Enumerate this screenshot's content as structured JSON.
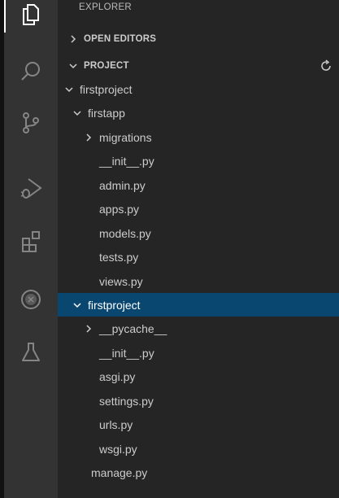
{
  "sidebar": {
    "title": "EXPLORER",
    "open_editors": "OPEN EDITORS",
    "project": "PROJECT"
  },
  "tree": {
    "root_folder": "firstproject",
    "app_folder": "firstapp",
    "app_items": {
      "migrations": "migrations",
      "init": "__init__.py",
      "admin": "admin.py",
      "apps": "apps.py",
      "models": "models.py",
      "tests": "tests.py",
      "views": "views.py"
    },
    "project_folder": "firstproject",
    "project_items": {
      "pycache": "__pycache__",
      "init": "__init__.py",
      "asgi": "asgi.py",
      "settings": "settings.py",
      "urls": "urls.py",
      "wsgi": "wsgi.py"
    },
    "manage": "manage.py"
  },
  "activity_bar": [
    "files-icon",
    "search-icon",
    "source-control-icon",
    "run-debug-icon",
    "extensions-icon",
    "remote-icon",
    "testing-icon"
  ]
}
